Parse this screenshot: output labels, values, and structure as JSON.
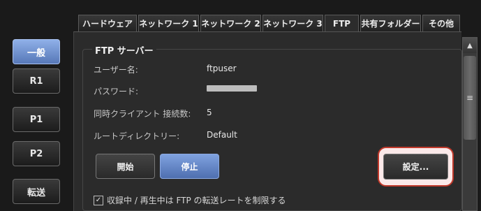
{
  "sidebar": {
    "items": [
      {
        "label": "一般",
        "active": true
      },
      {
        "label": "R1"
      },
      {
        "label": "P1"
      },
      {
        "label": "P2"
      },
      {
        "label": "転送"
      }
    ]
  },
  "tabs": [
    {
      "label": "ハードウェア"
    },
    {
      "label": "ネットワーク 1"
    },
    {
      "label": "ネットワーク 2"
    },
    {
      "label": "ネットワーク 3"
    },
    {
      "label": "FTP",
      "active": true
    },
    {
      "label": "共有フォルダー"
    },
    {
      "label": "その他"
    }
  ],
  "ftp": {
    "group_title": "FTP サーバー",
    "username_label": "ユーザー名:",
    "username_value": "ftpuser",
    "password_label": "パスワード:",
    "clients_label": "同時クライアント 接続数:",
    "clients_value": "5",
    "rootdir_label": "ルートディレクトリー:",
    "rootdir_value": "Default",
    "start_label": "開始",
    "stop_label": "停止",
    "settings_label": "設定...",
    "limit_checkbox_label": "収録中 / 再生中は FTP の転送レートを制限する",
    "limit_checked": true
  },
  "icons": {
    "scroll_up": "scroll-up-arrow-icon",
    "scroll_grip": "scroll-grip-icon",
    "checkbox": "checkbox-checked-icon"
  },
  "colors": {
    "active_blue": "#6f92d6",
    "highlight_red": "#c0392b",
    "background": "#1a1a1a"
  }
}
